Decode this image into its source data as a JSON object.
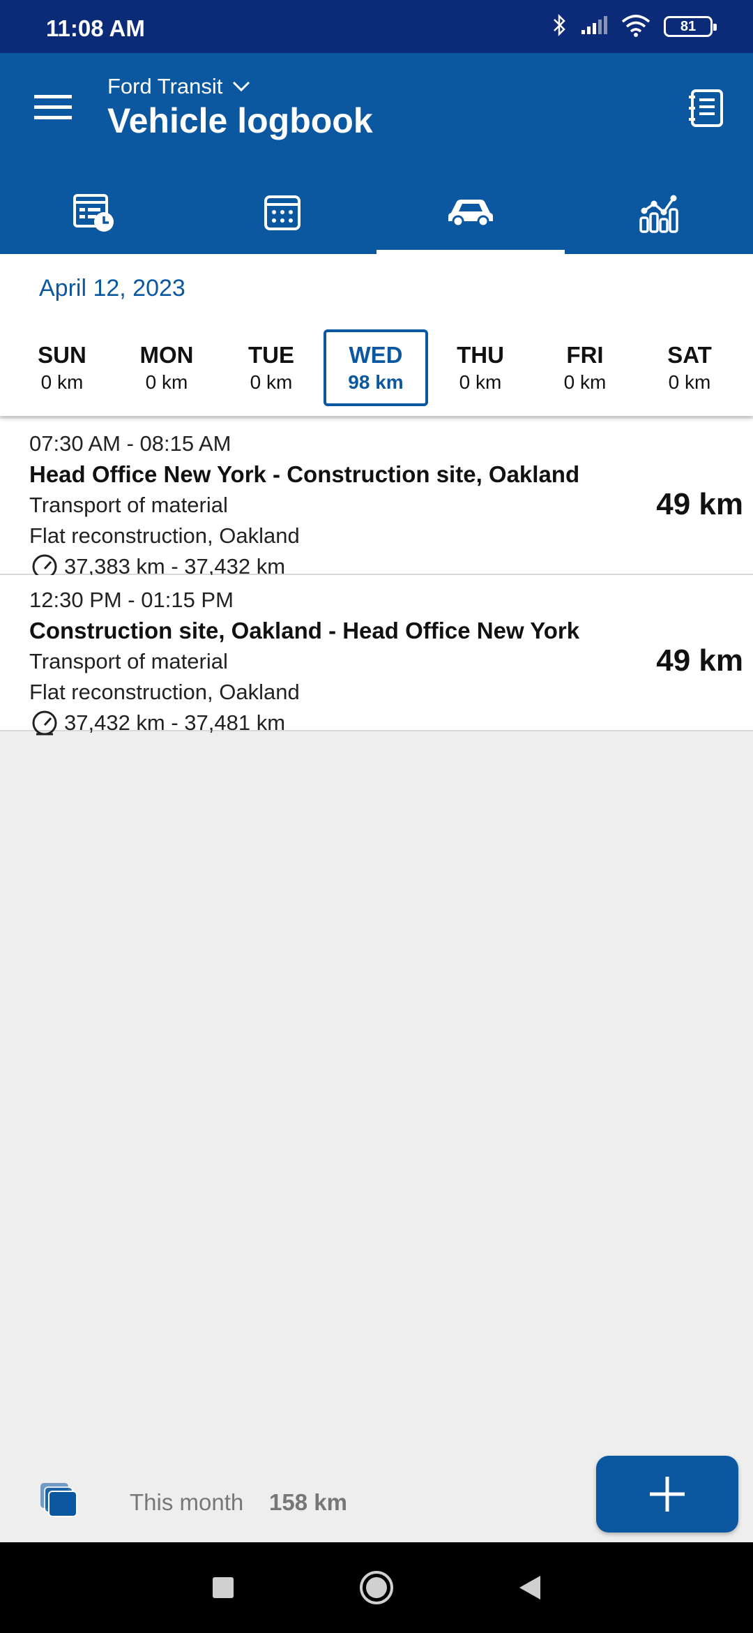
{
  "status_bar": {
    "time": "11:08 AM",
    "battery": "81"
  },
  "header": {
    "vehicle": "Ford Transit",
    "title": "Vehicle logbook"
  },
  "tabs": [
    {
      "icon": "timesheet-clock-icon",
      "active": false
    },
    {
      "icon": "calendar-icon",
      "active": false
    },
    {
      "icon": "car-icon",
      "active": true
    },
    {
      "icon": "statistics-chart-icon",
      "active": false
    }
  ],
  "week": {
    "date": "April 12, 2023",
    "days": [
      {
        "name": "SUN",
        "km": "0 km"
      },
      {
        "name": "MON",
        "km": "0 km"
      },
      {
        "name": "TUE",
        "km": "0 km"
      },
      {
        "name": "WED",
        "km": "98 km",
        "selected": true
      },
      {
        "name": "THU",
        "km": "0 km"
      },
      {
        "name": "FRI",
        "km": "0 km"
      },
      {
        "name": "SAT",
        "km": "0 km"
      }
    ]
  },
  "trips": [
    {
      "time": "07:30 AM - 08:15 AM",
      "route": "Head Office New York - Construction site, Oakland",
      "purpose": "Transport of material",
      "project": "Flat reconstruction, Oakland",
      "odometer": "37,383 km - 37,432 km",
      "distance": "49 km"
    },
    {
      "time": "12:30 PM - 01:15 PM",
      "route": "Construction site, Oakland - Head Office New York",
      "purpose": "Transport of material",
      "project": "Flat reconstruction, Oakland",
      "odometer": "37,432 km - 37,481 km",
      "distance": "49 km"
    }
  ],
  "footer": {
    "month_label": "This month",
    "month_value": "158 km"
  },
  "colors": {
    "primary": "#0b57a0",
    "status_bar": "#0b2a78"
  }
}
